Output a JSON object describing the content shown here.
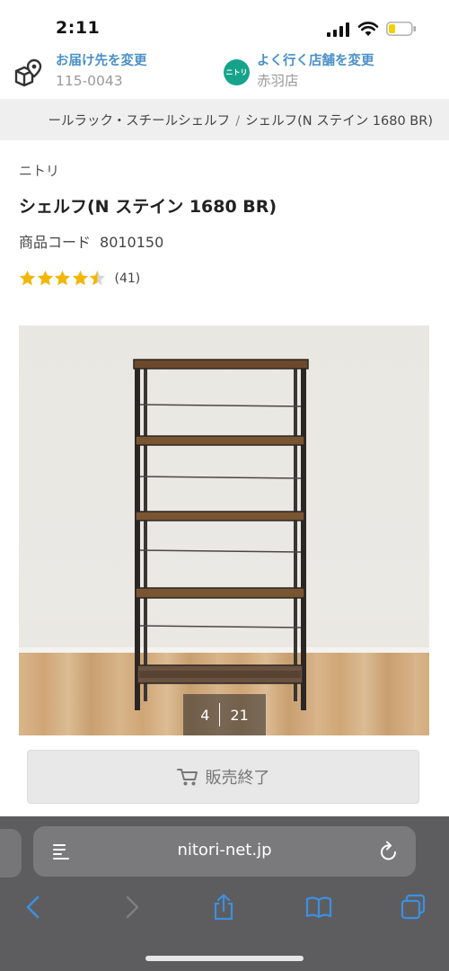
{
  "status": {
    "time": "2:11"
  },
  "header": {
    "delivery": {
      "link": "お届け先を変更",
      "value": "115-0043"
    },
    "store": {
      "badge": "ニトリ",
      "link": "よく行く店舗を変更",
      "value": "赤羽店"
    }
  },
  "breadcrumb": {
    "items": [
      "ールラック・スチールシェルフ",
      "シェルフ(N ステイン 1680 BR)"
    ],
    "separator": "/"
  },
  "product": {
    "brand": "ニトリ",
    "title": "シェルフ(N ステイン 1680 BR)",
    "code_label": "商品コード",
    "code_value": "8010150",
    "rating": 4.5,
    "review_count": "(41)"
  },
  "gallery": {
    "current": "4",
    "total": "21"
  },
  "purchase": {
    "sold_out_label": "販売終了"
  },
  "browser": {
    "url": "nitori-net.jp"
  },
  "icons": {
    "delivery": "delivery-box-pin-icon",
    "cart": "cart-icon",
    "reader": "reader-mode-icon",
    "reload": "reload-icon",
    "back": "back-chevron-icon",
    "forward": "forward-chevron-icon",
    "share": "share-icon",
    "bookmarks": "bookmarks-icon",
    "tabs": "tabs-icon"
  },
  "colors": {
    "link_blue": "#4a90c8",
    "star_gold": "#f2b705",
    "nitori_green": "#16a38a",
    "safari_toolbar": "#5d5d5f"
  }
}
